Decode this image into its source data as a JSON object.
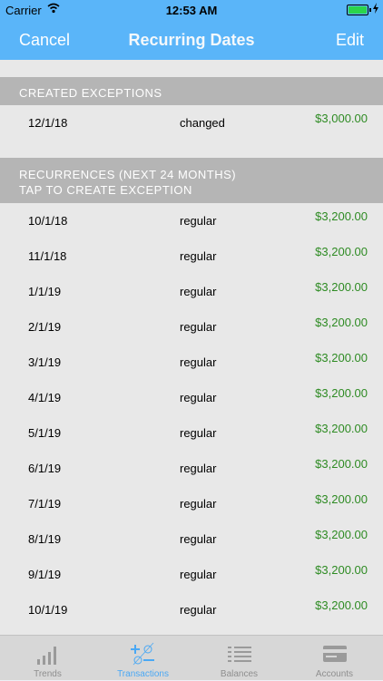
{
  "status_bar": {
    "carrier": "Carrier",
    "time": "12:53 AM"
  },
  "nav": {
    "cancel_label": "Cancel",
    "title": "Recurring Dates",
    "edit_label": "Edit"
  },
  "exceptions": {
    "header": "CREATED EXCEPTIONS",
    "rows": [
      {
        "date": "12/1/18",
        "kind": "changed",
        "amount": "$3,000.00"
      }
    ]
  },
  "recurrences": {
    "header_line1": "RECURRENCES (NEXT 24 MONTHS)",
    "header_line2": "TAP TO CREATE EXCEPTION",
    "rows": [
      {
        "date": "10/1/18",
        "kind": "regular",
        "amount": "$3,200.00"
      },
      {
        "date": "11/1/18",
        "kind": "regular",
        "amount": "$3,200.00"
      },
      {
        "date": "1/1/19",
        "kind": "regular",
        "amount": "$3,200.00"
      },
      {
        "date": "2/1/19",
        "kind": "regular",
        "amount": "$3,200.00"
      },
      {
        "date": "3/1/19",
        "kind": "regular",
        "amount": "$3,200.00"
      },
      {
        "date": "4/1/19",
        "kind": "regular",
        "amount": "$3,200.00"
      },
      {
        "date": "5/1/19",
        "kind": "regular",
        "amount": "$3,200.00"
      },
      {
        "date": "6/1/19",
        "kind": "regular",
        "amount": "$3,200.00"
      },
      {
        "date": "7/1/19",
        "kind": "regular",
        "amount": "$3,200.00"
      },
      {
        "date": "8/1/19",
        "kind": "regular",
        "amount": "$3,200.00"
      },
      {
        "date": "9/1/19",
        "kind": "regular",
        "amount": "$3,200.00"
      },
      {
        "date": "10/1/19",
        "kind": "regular",
        "amount": "$3,200.00"
      }
    ]
  },
  "tabbar": {
    "items": [
      {
        "label": "Trends",
        "icon": "trends-bars-icon"
      },
      {
        "label": "Transactions",
        "icon": "transactions-plus-minus-icon",
        "active": true
      },
      {
        "label": "Balances",
        "icon": "balances-list-icon"
      },
      {
        "label": "Accounts",
        "icon": "accounts-card-icon"
      }
    ]
  },
  "colors": {
    "nav": "#5ab5f9",
    "amount": "#2e8b23",
    "section_header": "#b5b5b5",
    "active_tab": "#4aa8f4"
  }
}
